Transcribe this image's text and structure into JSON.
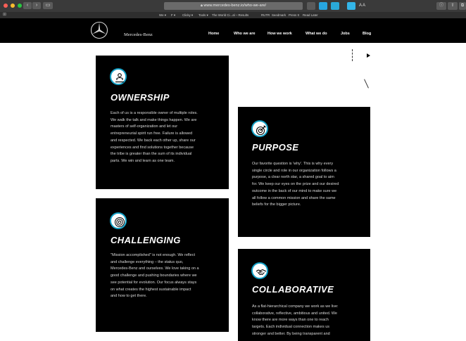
{
  "browser": {
    "url": "www.mercedes-benz.io/who-we-are/",
    "reader_label": "A A",
    "bookmarks": [
      "We ▾",
      "F ▾",
      "Clicky ▾",
      "Tools ▾",
      "The World Ci...al – Results",
      "RUTR",
      "Seedmark",
      "Press It",
      "Read Later"
    ]
  },
  "site": {
    "brand": "Mercedes-Benz",
    "nav": [
      "Home",
      "Who we are",
      "How we work",
      "What we do",
      "Jobs",
      "Blog"
    ]
  },
  "cards": {
    "ownership": {
      "title": "OWNERSHIP",
      "lines": [
        "Each of us is a responsible owner of multiple roles.",
        "We walk the talk and make things happen. We are",
        "masters of self-organization and let our",
        "entrepreneurial spirit run free. Failure is allowed",
        "and respected. We back each other up, share our",
        "experiences and find solutions together because",
        "the tribe is greater than the sum of its individual",
        "parts. We win and learn as one team."
      ]
    },
    "purpose": {
      "title": "PURPOSE",
      "lines": [
        "Our favorite question is 'why'. This is why every",
        "single circle and role in our organization follows a",
        "purpose, a clear north star, a shared goal to aim",
        "for. We keep our eyes on the prize and our desired",
        "outcome in the back of our mind to make sure we",
        "all follow a common mission and share the same",
        "beliefs for the bigger picture."
      ]
    },
    "challenging": {
      "title": "CHALLENGING",
      "lines": [
        "\"Mission accomplished\" is not enough. We reflect",
        "and challenge everything – the status quo,",
        "Mercedes-Benz and ourselves. We love taking on a",
        "good challenge and pushing boundaries where we",
        "see potential for evolution. Our focus always stays",
        "on what creates the highest sustainable impact",
        "and how to get there."
      ]
    },
    "collaborative": {
      "title": "COLLABORATIVE",
      "lines": [
        "As a flat-hierarchical company we work as we live:",
        "collaborative, reflective, ambitious and united. We",
        "know there are more ways than one to reach",
        "targets. Each individual connection makes us",
        "stronger and better. By being transparent and"
      ]
    }
  },
  "colors": {
    "icon_ring": "#12a0c6",
    "card_bg": "#000000"
  },
  "icons": {
    "ownership": "person-hand-icon",
    "purpose": "target-icon",
    "challenging": "spiral-target-icon",
    "collaborative": "handshake-icon"
  }
}
